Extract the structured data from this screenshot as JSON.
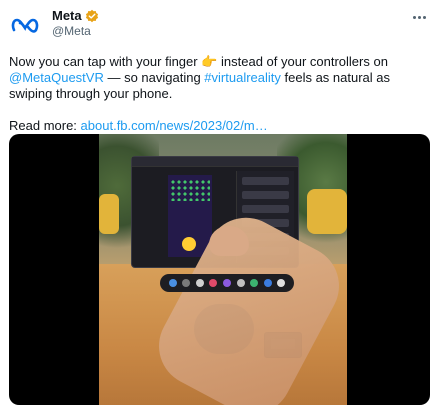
{
  "account": {
    "display_name": "Meta",
    "handle": "@Meta",
    "verified_color": "#e8a317",
    "logo_color": "#0668e1"
  },
  "tweet": {
    "text_part1": "Now you can tap with your finger ",
    "emoji": "👉",
    "text_part2": " instead of your controllers on ",
    "mention": "@MetaQuestVR",
    "text_part3": " — so navigating ",
    "hashtag": "#virtualreality",
    "text_part4": " feels as natural as swiping through your phone.",
    "read_more_label": "Read more: ",
    "read_more_link": "about.fb.com/news/2023/02/m…"
  },
  "colors": {
    "link": "#1d9bf0",
    "text": "#0f1419",
    "secondary": "#536471"
  },
  "icons": {
    "more": "more-options-icon",
    "verified": "verified-badge-icon",
    "logo": "meta-logo-icon"
  }
}
